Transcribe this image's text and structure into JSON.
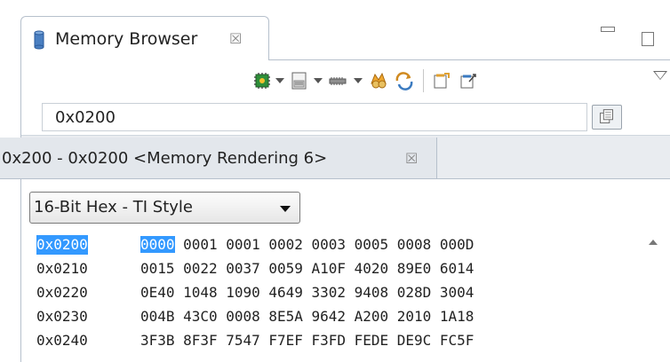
{
  "view_tab": {
    "title": "Memory Browser",
    "close_glyph": "☒",
    "icon": "cylinder-database-icon"
  },
  "window_controls": [
    "minimize-icon",
    "maximize-icon",
    "view-menu-icon"
  ],
  "toolbar": {
    "items": [
      "new-memory-rendering-icon",
      "chip-memory-icon",
      "refresh-icon",
      "load-memory-icon",
      "save-memory-icon",
      "import-icon",
      "export-icon"
    ]
  },
  "address": {
    "value": "0x0200",
    "go_icon": "go-to-address-icon"
  },
  "rendering_tab": {
    "label": "0x200 - 0x0200 <Memory Rendering 6>",
    "close_glyph": "☒"
  },
  "format": {
    "selected": "16-Bit Hex - TI Style"
  },
  "memory": {
    "rows": [
      {
        "addr": "0x0200",
        "words": [
          "0000",
          "0001",
          "0001",
          "0002",
          "0003",
          "0005",
          "0008",
          "000D"
        ]
      },
      {
        "addr": "0x0210",
        "words": [
          "0015",
          "0022",
          "0037",
          "0059",
          "A10F",
          "4020",
          "89E0",
          "6014"
        ]
      },
      {
        "addr": "0x0220",
        "words": [
          "0E40",
          "1048",
          "1090",
          "4649",
          "3302",
          "9408",
          "028D",
          "3004"
        ]
      },
      {
        "addr": "0x0230",
        "words": [
          "004B",
          "43C0",
          "0008",
          "8E5A",
          "9642",
          "A200",
          "2010",
          "1A18"
        ]
      },
      {
        "addr": "0x0240",
        "words": [
          "3F3B",
          "8F3F",
          "7547",
          "F7EF",
          "F3FD",
          "FEDE",
          "DE9C",
          "FC5F"
        ]
      }
    ]
  },
  "colors": {
    "selection": "#3399ff",
    "tab_border": "#b6c0cc",
    "rendering_tab_bg": "#e3e7ec"
  }
}
